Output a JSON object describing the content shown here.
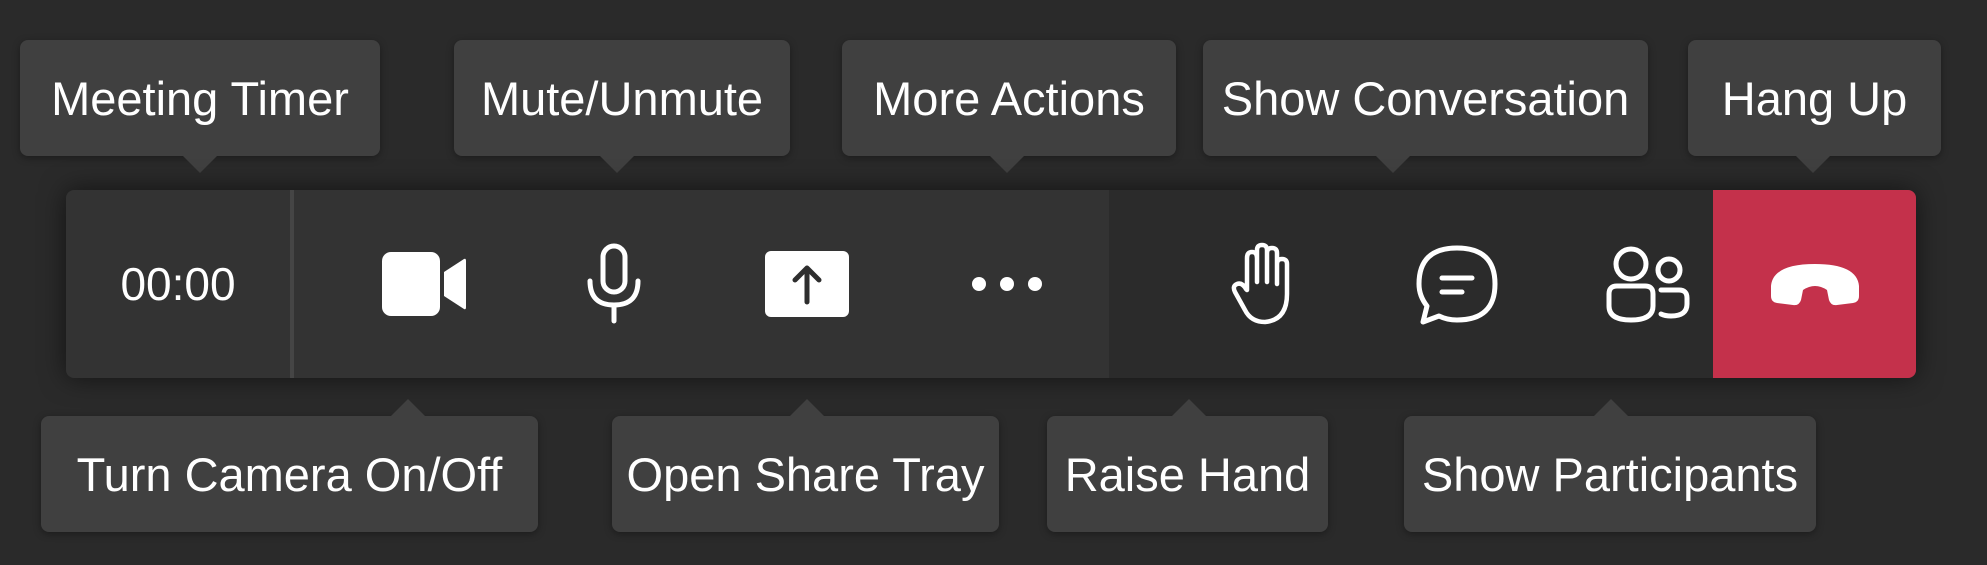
{
  "toolbar": {
    "timer": "00:00",
    "buttons": [
      {
        "name": "camera",
        "icon": "video-camera-icon"
      },
      {
        "name": "mute",
        "icon": "microphone-icon"
      },
      {
        "name": "share",
        "icon": "share-tray-icon"
      },
      {
        "name": "more",
        "icon": "more-actions-icon"
      },
      {
        "name": "raise-hand",
        "icon": "raise-hand-icon"
      },
      {
        "name": "conversation",
        "icon": "chat-bubble-icon"
      },
      {
        "name": "participants",
        "icon": "participants-icon"
      },
      {
        "name": "hang-up",
        "icon": "hang-up-phone-icon"
      }
    ],
    "hangup_color": "#c4314b"
  },
  "tooltips": {
    "meeting_timer": "Meeting Timer",
    "mute_unmute": "Mute/Unmute",
    "more_actions": "More Actions",
    "show_conversation": "Show Conversation",
    "hang_up": "Hang Up",
    "turn_camera": "Turn Camera On/Off",
    "open_share_tray": "Open Share Tray",
    "raise_hand": "Raise Hand",
    "show_participants": "Show Participants"
  }
}
